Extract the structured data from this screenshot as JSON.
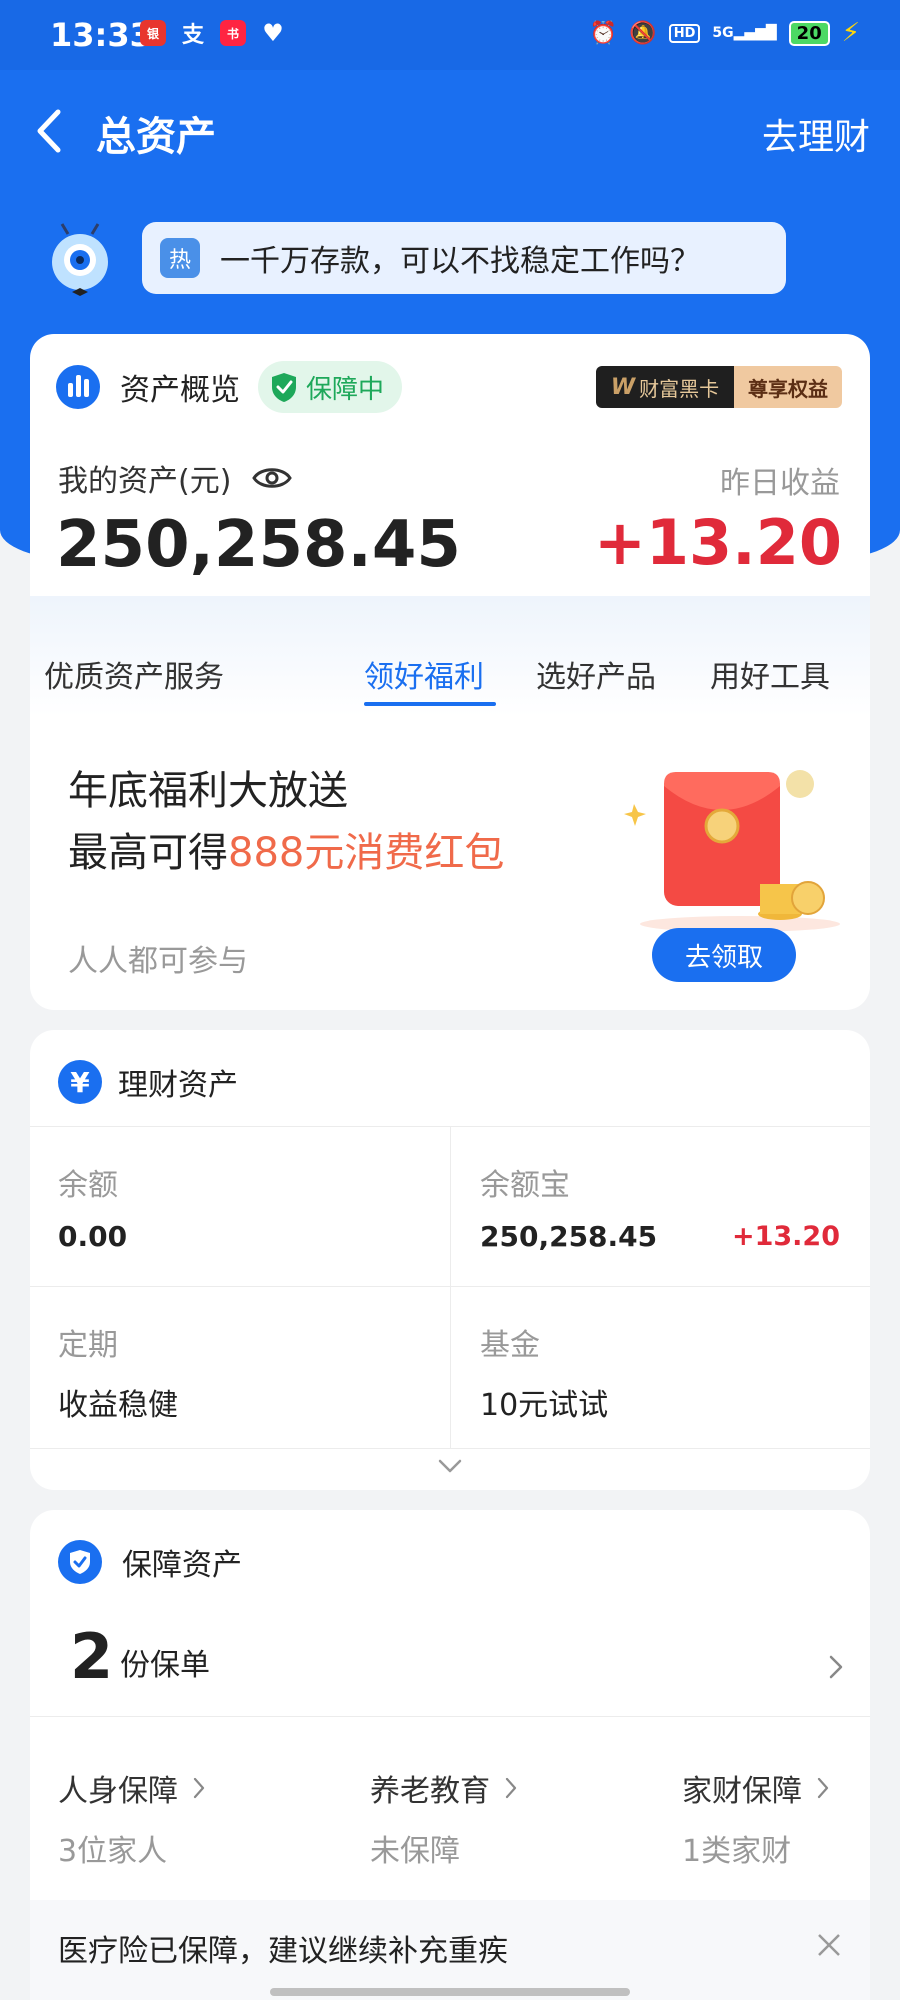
{
  "status_bar": {
    "time": "13:33",
    "apps": [
      {
        "name": "bank-app-icon",
        "glyph": "银",
        "color": "#e8352e"
      },
      {
        "name": "alipay-app-icon",
        "glyph": "支",
        "color": "transparent"
      },
      {
        "name": "xiaohongshu-app-icon",
        "glyph": "书",
        "color": "#ff2442"
      },
      {
        "name": "health-app-icon",
        "glyph": "♥",
        "color": "transparent"
      }
    ],
    "hd_label": "HD",
    "signal_label": "5G",
    "battery": "20"
  },
  "nav": {
    "title": "总资产",
    "right_action": "去理财"
  },
  "hot_topic": {
    "tag": "热",
    "text": "一千万存款，可以不找稳定工作吗？"
  },
  "overview": {
    "title": "资产概览",
    "badge": "保障中",
    "black_card_left": "财富黑卡",
    "black_card_right": "尊享权益",
    "my_assets_label": "我的资产(元)",
    "yesterday_label": "昨日收益",
    "total_assets": "250,258.45",
    "yesterday_earnings": "+13.20",
    "tabs": [
      {
        "label": "优质资产服务",
        "active": false
      },
      {
        "label": "领好福利",
        "active": true
      },
      {
        "label": "选好产品",
        "active": false
      },
      {
        "label": "用好工具",
        "active": false
      }
    ],
    "promo_line1": "年底福利大放送",
    "promo_line2_prefix": "最高可得",
    "promo_line2_highlight": "888元消费红包",
    "promo_sub": "人人都可参与",
    "promo_button": "去领取"
  },
  "wealth": {
    "title": "理财资产",
    "cells": [
      {
        "label": "余额",
        "value": "0.00",
        "extra": ""
      },
      {
        "label": "余额宝",
        "value": "250,258.45",
        "extra": "+13.20"
      },
      {
        "label": "定期",
        "value": "收益稳健",
        "extra": ""
      },
      {
        "label": "基金",
        "value": "10元试试",
        "extra": ""
      }
    ]
  },
  "protection": {
    "title": "保障资产",
    "policy_count": "2",
    "policy_unit": "份保单",
    "categories": [
      {
        "title": "人身保障",
        "sub": "3位家人"
      },
      {
        "title": "养老教育",
        "sub": "未保障"
      },
      {
        "title": "家财保障",
        "sub": "1类家财"
      }
    ],
    "tip": "医疗险已保障，建议继续补充重疾"
  },
  "colors": {
    "brand_blue": "#1a6ff0",
    "profit_red": "#e02a3a",
    "highlight_orange": "#f06a4a",
    "safe_green": "#1ea85a"
  }
}
